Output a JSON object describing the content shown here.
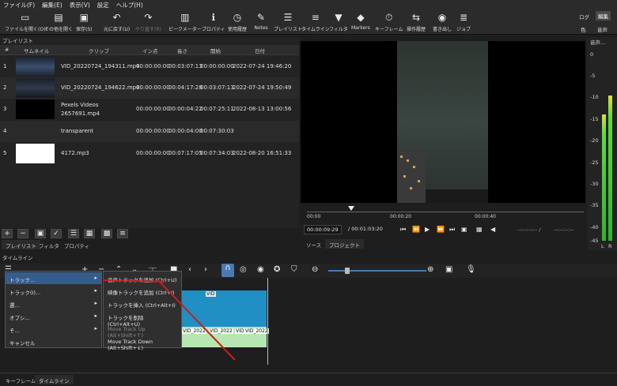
{
  "menubar": [
    "ファイル(F)",
    "編集(E)",
    "表示(V)",
    "設定",
    "ヘルプ(H)"
  ],
  "toolbar": {
    "open_label": "ファイルを開く(O)",
    "open_other_label": "その他を開く",
    "save_label": "保存(S)",
    "undo_label": "元に戻す(U)",
    "redo_label": "やり直す(R)",
    "peak_label": "ピークメーター",
    "properties_label": "プロパティ",
    "history_label": "使用履歴",
    "notes_label": "Notes",
    "playlist_label": "プレイリスト",
    "timeline_label": "タイムライン",
    "filter_label": "フィルタ",
    "markers_label": "Markers",
    "keyframe_label": "キーフレーム",
    "jobs_label": "操作履歴",
    "export_label": "書き出し",
    "job_label": "ジョブ",
    "layout_logging": "ログ",
    "layout_editing": "編集",
    "layout_color": "色",
    "layout_audio": "音声"
  },
  "playlist": {
    "title": "プレイリスト",
    "columns": [
      "#",
      "サムネイル",
      "クリップ",
      "イン点",
      "長さ",
      "開始",
      "日付"
    ],
    "rows": [
      {
        "num": "1",
        "clip": "VID_20220724_194311.mp4",
        "in": "00:00:00:00",
        "duration": "00:03:07:13",
        "start": "00:00:00:00",
        "date": "2022-07-24 19:46:20",
        "thumb_color": "#2a3a55"
      },
      {
        "num": "2",
        "clip": "VID_20220724_194622.mp4",
        "in": "00:00:00:00",
        "duration": "00:04:17:28",
        "start": "00:03:07:13",
        "date": "2022-07-24 19:50:49",
        "thumb_color": "#2a3240"
      },
      {
        "num": "3",
        "clip": "Pexels Videos",
        "clip2": "2657691.mp4",
        "in": "00:00:00:00",
        "duration": "00:00:04:22",
        "start": "00:07:25:11",
        "date": "2022-08-13 13:00:56",
        "thumb_color": "#000000"
      },
      {
        "num": "4",
        "clip": "transparent",
        "in": "00:00:00:00",
        "duration": "00:00:04:00",
        "start": "00:07:30:03",
        "date": "",
        "thumb_color": ""
      },
      {
        "num": "5",
        "clip": "4172.mp3",
        "in": "00:00:00:00",
        "duration": "00:07:17:05",
        "start": "00:07:34:03",
        "date": "2022-08-20 16:51:33",
        "thumb_color": "#ffffff"
      }
    ],
    "tabs": [
      "プレイリスト",
      "フィルタ",
      "プロパティ"
    ]
  },
  "viewer": {
    "ruler_ticks": [
      "00:00",
      "00:00:20",
      "00:00:40"
    ],
    "current_time": "00:00:09:29",
    "total_time": "/ 00:01:03:20",
    "in_point": "--:--:--:-- /",
    "out_point": "--:--:--:--",
    "tabs": [
      "ソース",
      "プロジェクト"
    ]
  },
  "meter": {
    "title": "音声...",
    "labels": [
      "0",
      "-5",
      "-10",
      "-15",
      "-20",
      "-25",
      "-30",
      "-35",
      "-40",
      "-45",
      "-50"
    ],
    "channels": [
      "L",
      "R"
    ]
  },
  "timeline": {
    "title": "タイムライン",
    "clip_labels": [
      "VID_2022",
      "VID_2022",
      "VID",
      "VID_2022"
    ],
    "video_clip_label": "VID"
  },
  "context_menu": {
    "items": [
      "トラック...",
      "トラック(I)...",
      "選...",
      "オプシ...",
      "そ...",
      "キャンセル"
    ],
    "submenu": [
      "音声トラックを追加 (Ctrl+U)",
      "映像トラックを追加 (Ctrl+I)",
      "トラックを挿入 (Ctrl+Alt+I)",
      "トラックを削除 (Ctrl+Alt+U)",
      "Move Track Up (Alt+Shift+↑)",
      "Move Track Down (Alt+Shift+↓)"
    ]
  },
  "bottom_tabs": [
    "キーフレーム",
    "タイムライン"
  ],
  "colors": {
    "accent": "#365c8c",
    "annotation": "#c81e1e",
    "track_video": "#1f8fc4",
    "track_audio": "#b8e6b2"
  }
}
